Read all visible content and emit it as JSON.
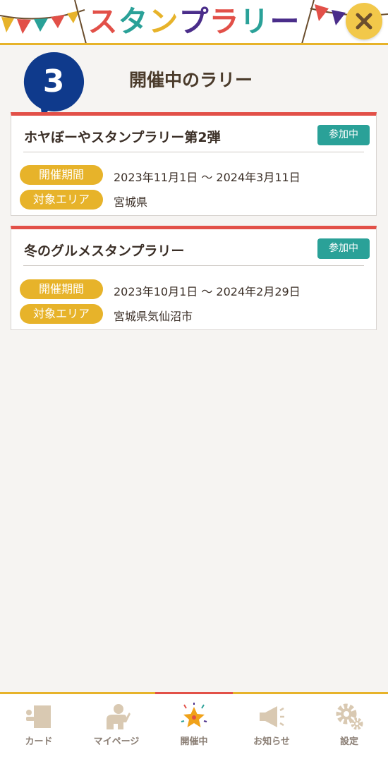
{
  "header": {
    "logo_text": "スタンプラリー",
    "close_label": "×"
  },
  "step_number": "3",
  "page_title": "開催中のラリー",
  "rallies": [
    {
      "title": "ホヤぼーやスタンプラリー第2弾",
      "status": "参加中",
      "period_label": "開催期間",
      "period": "2023年11月1日 〜 2024年3月11日",
      "area_label": "対象エリア",
      "area": "宮城県"
    },
    {
      "title": "冬のグルメスタンプラリー",
      "status": "参加中",
      "period_label": "開催期間",
      "period": "2023年10月1日 〜 2024年2月29日",
      "area_label": "対象エリア",
      "area": "宮城県気仙沼市"
    }
  ],
  "nav": [
    {
      "label": "カード",
      "icon": "card-icon"
    },
    {
      "label": "マイページ",
      "icon": "person-icon"
    },
    {
      "label": "開催中",
      "icon": "star-icon",
      "active": true
    },
    {
      "label": "お知らせ",
      "icon": "megaphone-icon"
    },
    {
      "label": "設定",
      "icon": "gear-icon"
    }
  ],
  "colors": {
    "accent_red": "#e25048",
    "accent_yellow": "#e7b32a",
    "badge_teal": "#2aa198",
    "step_blue": "#0f3a8c"
  }
}
